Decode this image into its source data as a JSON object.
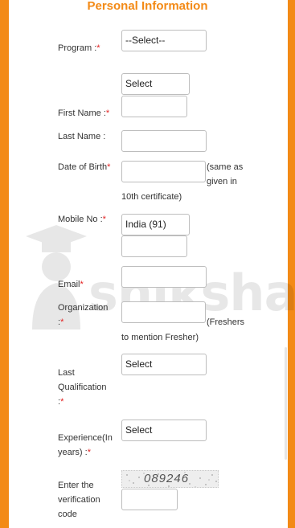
{
  "page": {
    "title": "Personal Information"
  },
  "required_mark": "*",
  "fields": {
    "program": {
      "label": "Program :",
      "value": "--Select--"
    },
    "first_name": {
      "label": "First Name :",
      "salutation": "Select",
      "value": ""
    },
    "last_name": {
      "label": "Last Name :",
      "value": ""
    },
    "dob": {
      "label": "Date of Birth",
      "value": "",
      "note_line1": "(same as",
      "note_line2": "given in",
      "note_line3": "10th certificate)"
    },
    "mobile": {
      "label": "Mobile No :",
      "country": "India (91)",
      "value": ""
    },
    "email": {
      "label": "Email",
      "value": ""
    },
    "organization": {
      "label_line1": "Organization",
      "label_line2": ":",
      "value": "",
      "note_line1": "(Freshers",
      "note_line2": "to mention Fresher)"
    },
    "last_qualification": {
      "label_line1": "Last",
      "label_line2": "Qualification",
      "label_line3": ":",
      "value": "Select"
    },
    "experience": {
      "label_line1": "Experience(In",
      "label_line2": "years) :",
      "value": "Select"
    },
    "verification": {
      "label_line1": "Enter the",
      "label_line2": "verification",
      "label_line3": "code",
      "captcha_text": "089246",
      "value": ""
    }
  },
  "watermark": {
    "text": "shiksha"
  }
}
